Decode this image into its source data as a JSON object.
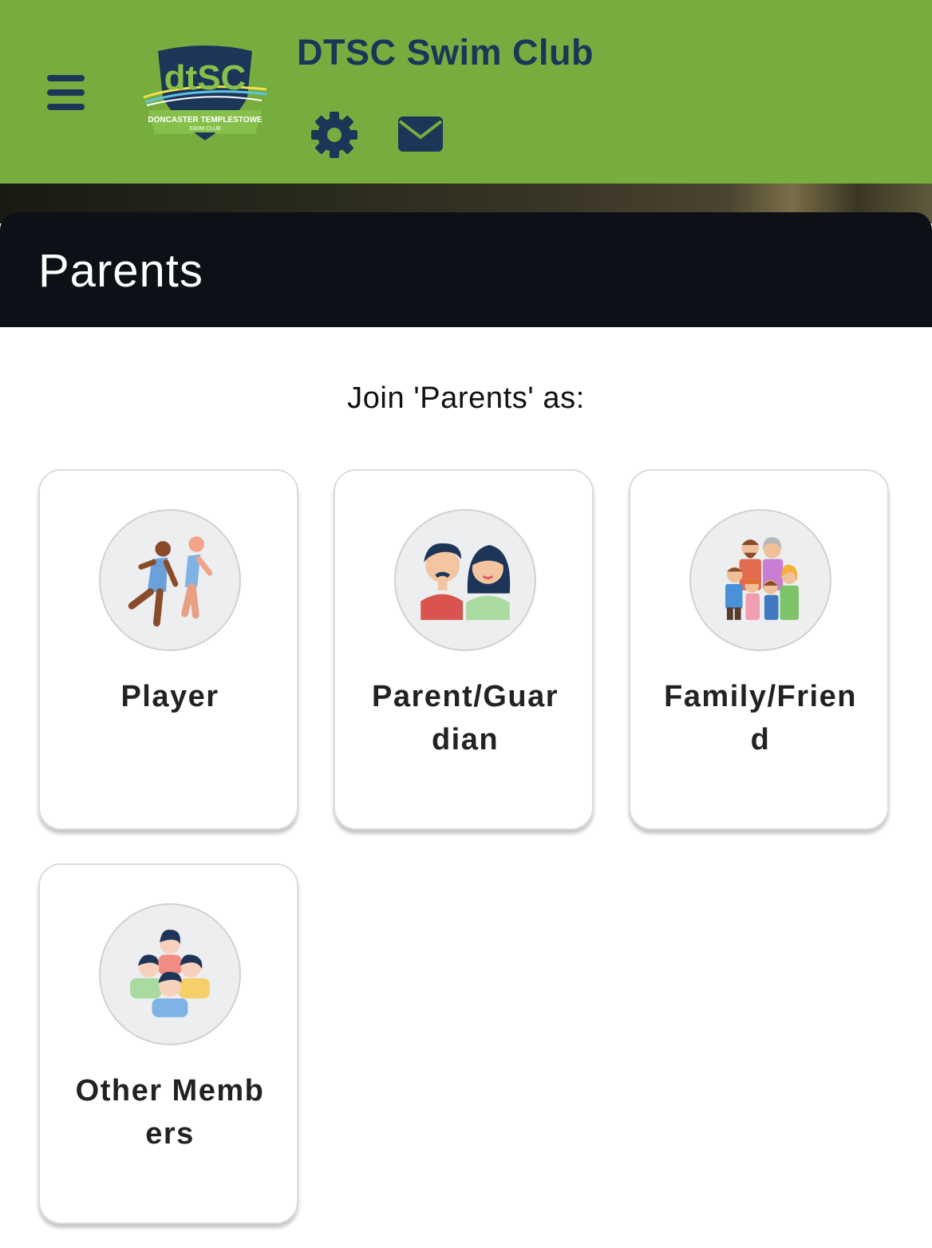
{
  "header": {
    "club_name": "DTSC Swim Club",
    "logo_text": "dtSC",
    "logo_subtitle": "DONCASTER TEMPLESTOWE",
    "logo_subtitle2": "SWIM CLUB",
    "menu_icon": "hamburger-menu-icon",
    "settings_icon": "gear-icon",
    "mail_icon": "envelope-icon",
    "bar_color": "#77ad3f",
    "accent_color": "#1d3557"
  },
  "page": {
    "title": "Parents",
    "prompt": "Join 'Parents' as:"
  },
  "roles": [
    {
      "label": "Player",
      "icon": "runners-icon"
    },
    {
      "label": "Parent/Guardian",
      "icon": "parents-icon"
    },
    {
      "label": "Family/Friend",
      "icon": "family-icon"
    },
    {
      "label": "Other Members",
      "icon": "group-members-icon"
    }
  ]
}
